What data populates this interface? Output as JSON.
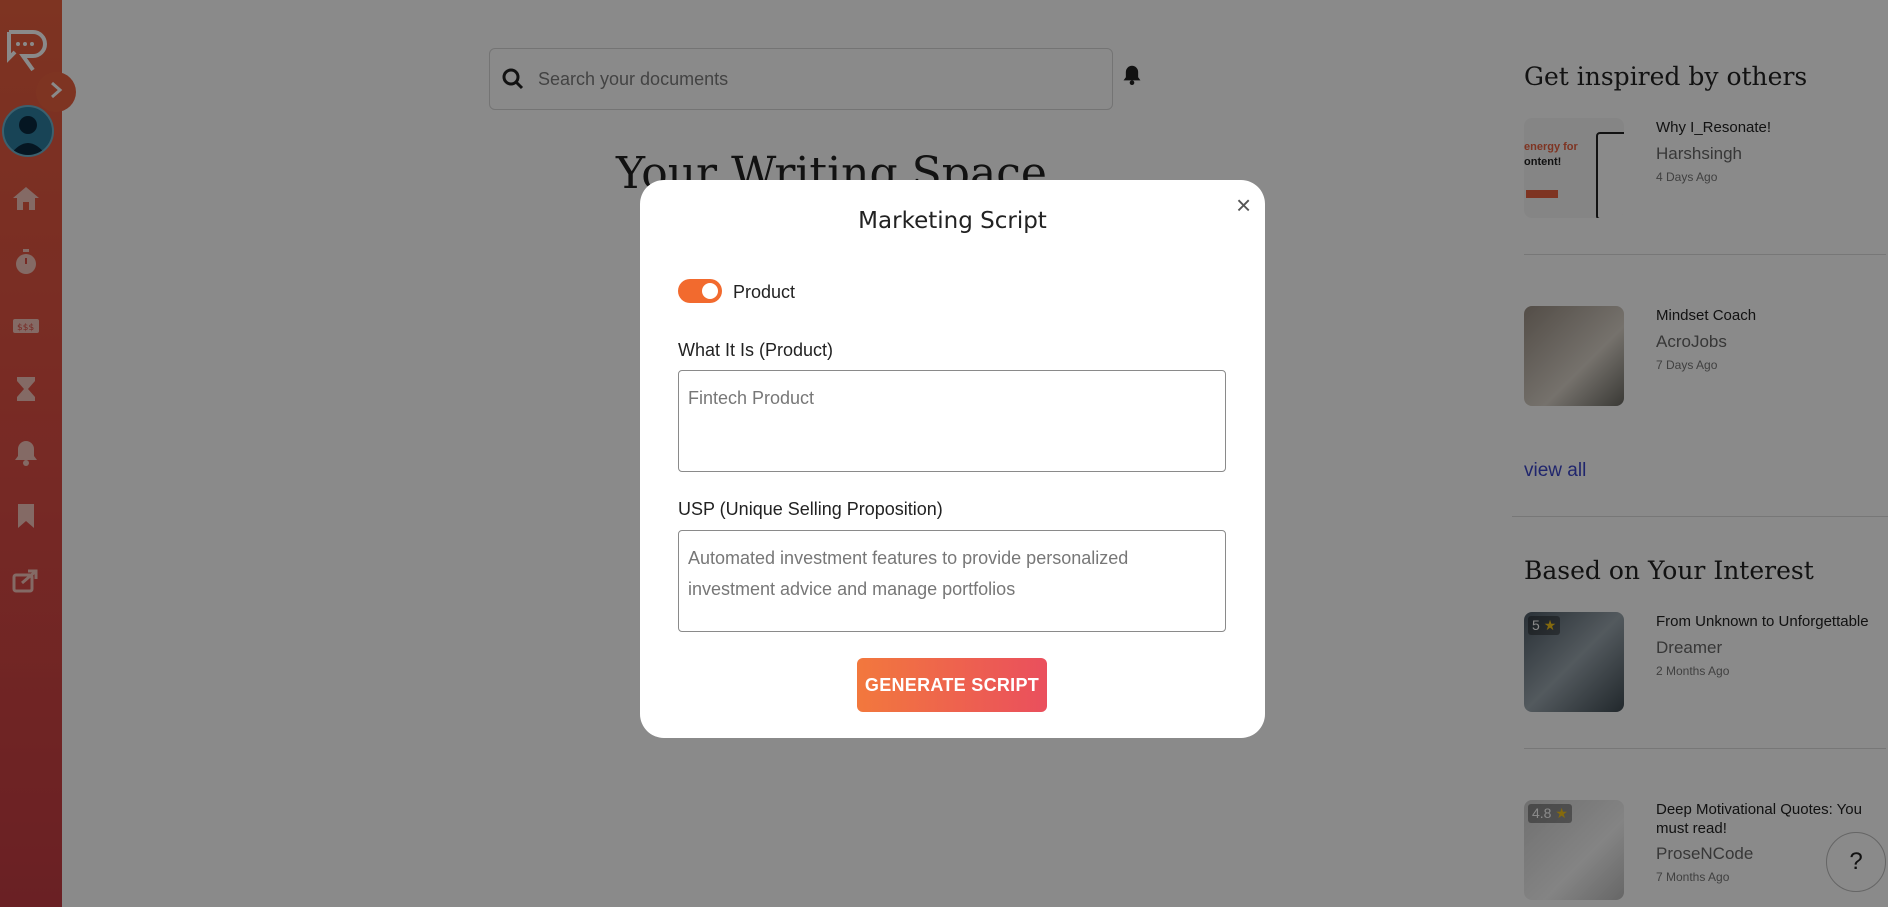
{
  "app": {
    "search_placeholder": "Search your documents",
    "main_heading": "Your Writing Space"
  },
  "sidebar": {
    "icons": [
      "logo-icon",
      "chevron-right-icon",
      "avatar",
      "home-icon",
      "stopwatch-icon",
      "ticket-icon",
      "hourglass-icon",
      "bell-icon",
      "bookmark-icon",
      "share-icon"
    ]
  },
  "right_panel": {
    "inspired_title": "Get inspired by others",
    "inspired": [
      {
        "title": "Why I_Resonate!",
        "author": "Harshsingh",
        "date": "4 Days Ago"
      },
      {
        "title": "Mindset Coach",
        "author": "AcroJobs",
        "date": "7 Days Ago"
      }
    ],
    "view_all": "view all",
    "interest_title": "Based on Your Interest",
    "interest": [
      {
        "title": "From Unknown to Unforgettable",
        "author": "Dreamer",
        "date": "2 Months Ago",
        "rating": "5"
      },
      {
        "title": "Deep Motivational Quotes: You must read!",
        "author": "ProseNCode",
        "date": "7 Months Ago",
        "rating": "4.8"
      }
    ],
    "thumb_text": [
      "energy for",
      "ontent!"
    ]
  },
  "modal": {
    "title": "Marketing Script",
    "close": "×",
    "toggle_label": "Product",
    "toggle_on": true,
    "field1_label": "What It Is (Product)",
    "field1_value": "Fintech Product",
    "field2_label": "USP (Unique Selling Proposition)",
    "field2_value": "Automated investment features to provide personalized investment advice and manage portfolios",
    "button": "GENERATE SCRIPT"
  },
  "help": {
    "label": "?"
  },
  "colors": {
    "accent": "#f26a2e",
    "sidebar": "#dd4e45",
    "link": "#3c46c9"
  }
}
